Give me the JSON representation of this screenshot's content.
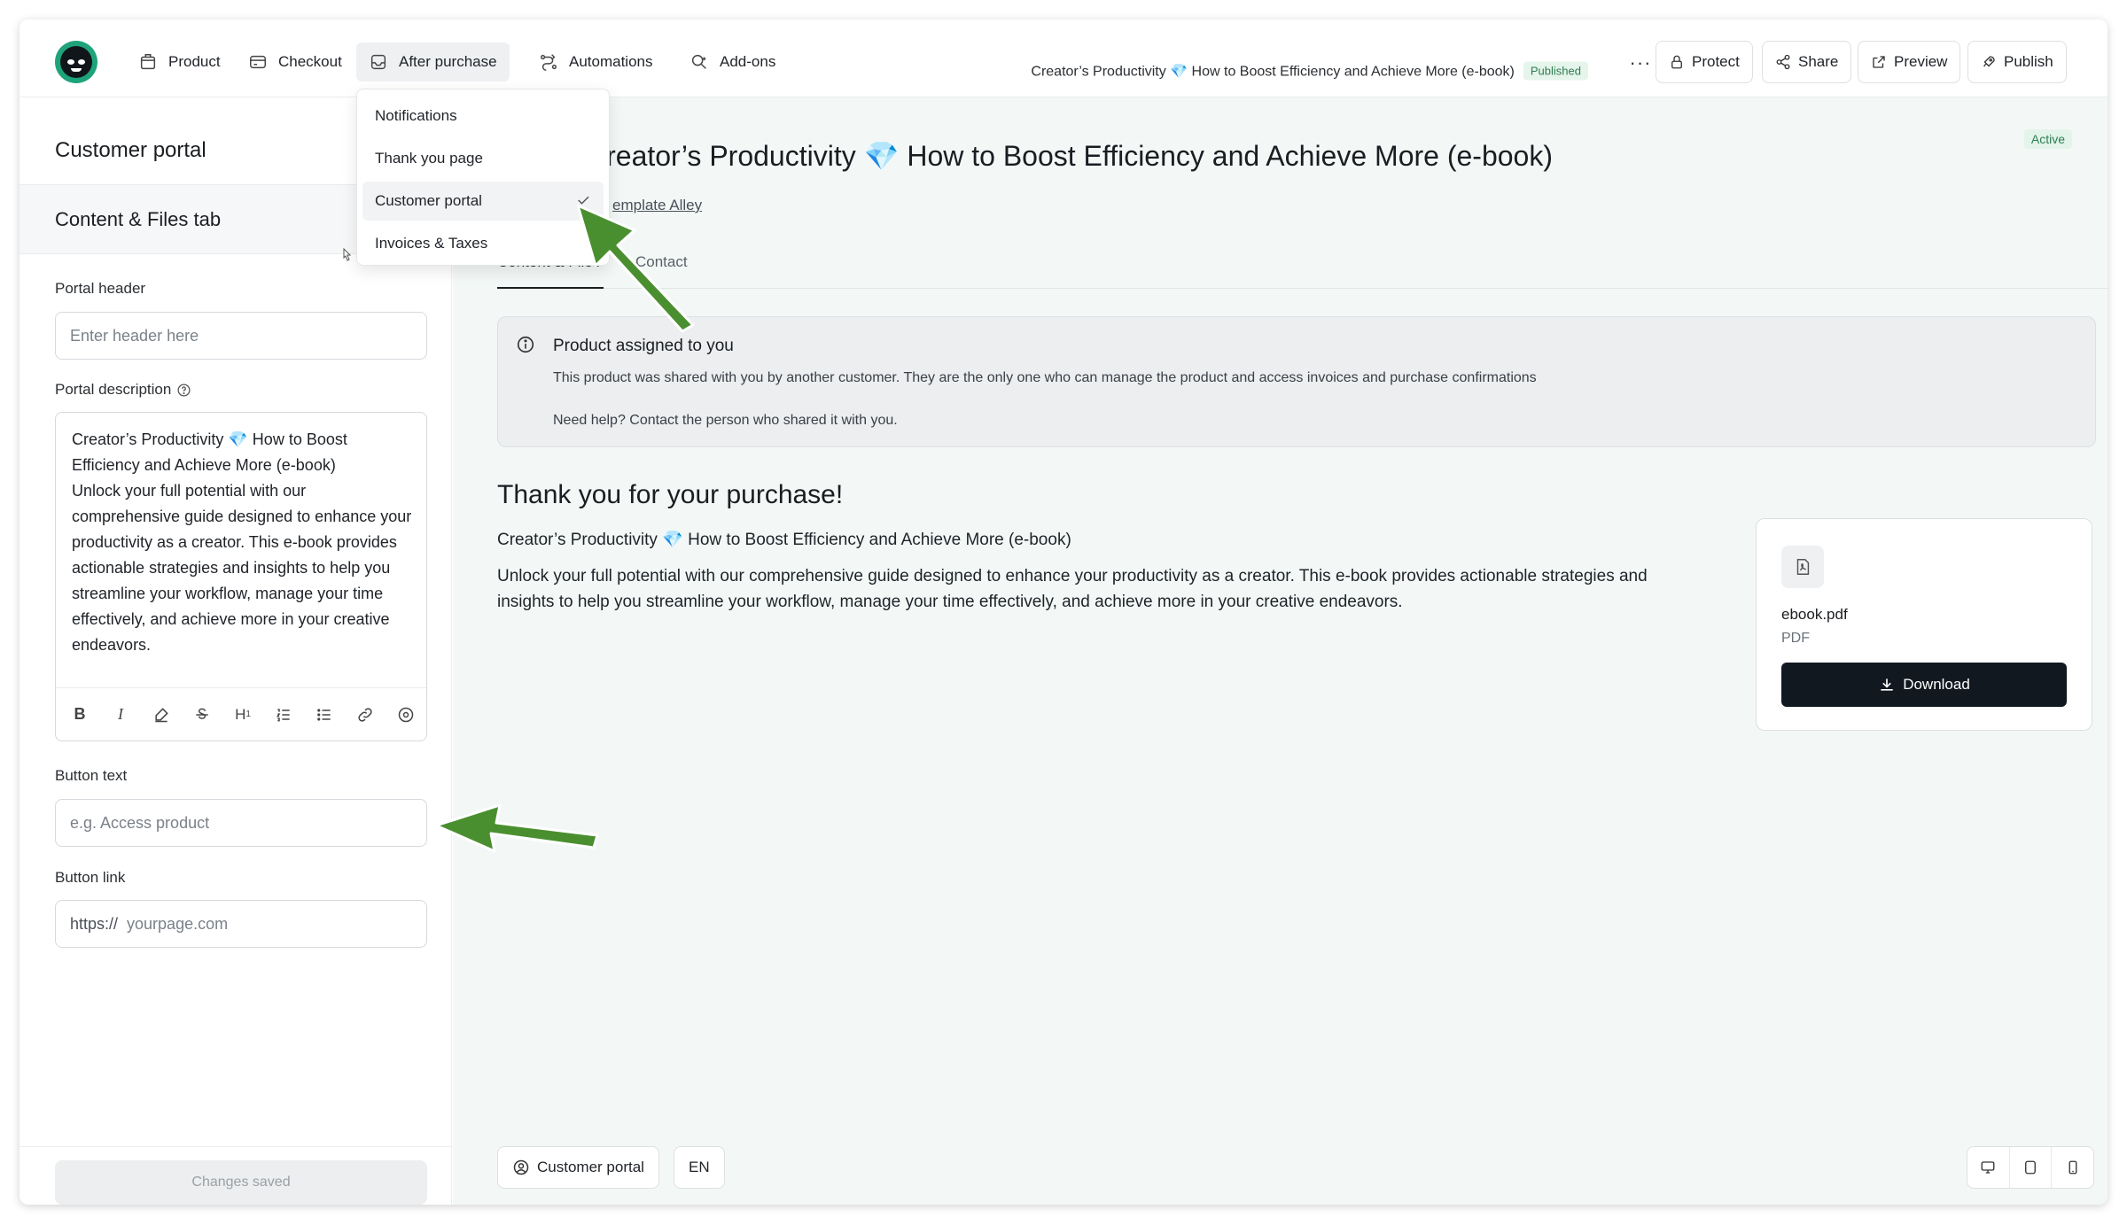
{
  "nav": {
    "items": [
      {
        "label": "Product",
        "icon": "box-icon"
      },
      {
        "label": "Checkout",
        "icon": "cart-icon"
      },
      {
        "label": "After purchase",
        "icon": "inbox-icon"
      },
      {
        "label": "Automations",
        "icon": "flow-icon"
      },
      {
        "label": "Add-ons",
        "icon": "addon-icon"
      }
    ],
    "product_title": "Creator’s Productivity 💎 How to Boost Efficiency and Achieve More (e-book)",
    "status_badge": "Published",
    "more_label": "···",
    "buttons": {
      "protect": "Protect",
      "share": "Share",
      "preview": "Preview",
      "publish": "Publish"
    }
  },
  "dropdown": {
    "items": [
      "Notifications",
      "Thank you page",
      "Customer portal",
      "Invoices & Taxes"
    ],
    "selected": "Customer portal"
  },
  "left": {
    "title": "Customer portal",
    "tab": "Content & Files tab",
    "portal_header_label": "Portal header",
    "portal_header_placeholder": "Enter header here",
    "portal_description_label": "Portal description",
    "portal_description_value": "Creator’s Productivity 💎 How to Boost Efficiency and Achieve More (e-book)\nUnlock your full potential with our comprehensive guide designed to enhance your productivity as a creator. This e-book provides actionable strategies and insights to help you streamline your workflow, manage your time effectively, and achieve more in your creative endeavors.",
    "button_text_label": "Button text",
    "button_text_placeholder": "e.g. Access product",
    "button_link_label": "Button link",
    "button_link_prefix": "https://",
    "button_link_placeholder": "yourpage.com",
    "saved_label": "Changes saved"
  },
  "preview": {
    "active_badge": "Active",
    "title": "Creator’s Productivity 💎 How to Boost Efficiency and Achieve More (e-book)",
    "author_link": "emplate Alley",
    "tabs": [
      "Content & Files",
      "Contact"
    ],
    "info_title": "Product assigned to you",
    "info_line1": "This product was shared with you by another customer. They are the only one who can manage the product and access invoices and purchase confirmations",
    "info_line2": "Need help? Contact the person who shared it with you.",
    "thanks": "Thank you for your purchase!",
    "product_name": "Creator’s Productivity 💎 How to Boost Efficiency and Achieve More (e-book)",
    "product_desc": "Unlock your full potential with our comprehensive guide designed to enhance your productivity as a creator. This e-book provides actionable strategies and insights to help you streamline your workflow, manage your time effectively, and achieve more in your creative endeavors.",
    "file_name": "ebook.pdf",
    "file_type": "PDF",
    "download_label": "Download",
    "portal_button": "Customer portal",
    "lang_button": "EN"
  },
  "colors": {
    "accent_green": "#1ea37a",
    "arrow_green": "#4a8f2f",
    "dark_button": "#111820"
  }
}
